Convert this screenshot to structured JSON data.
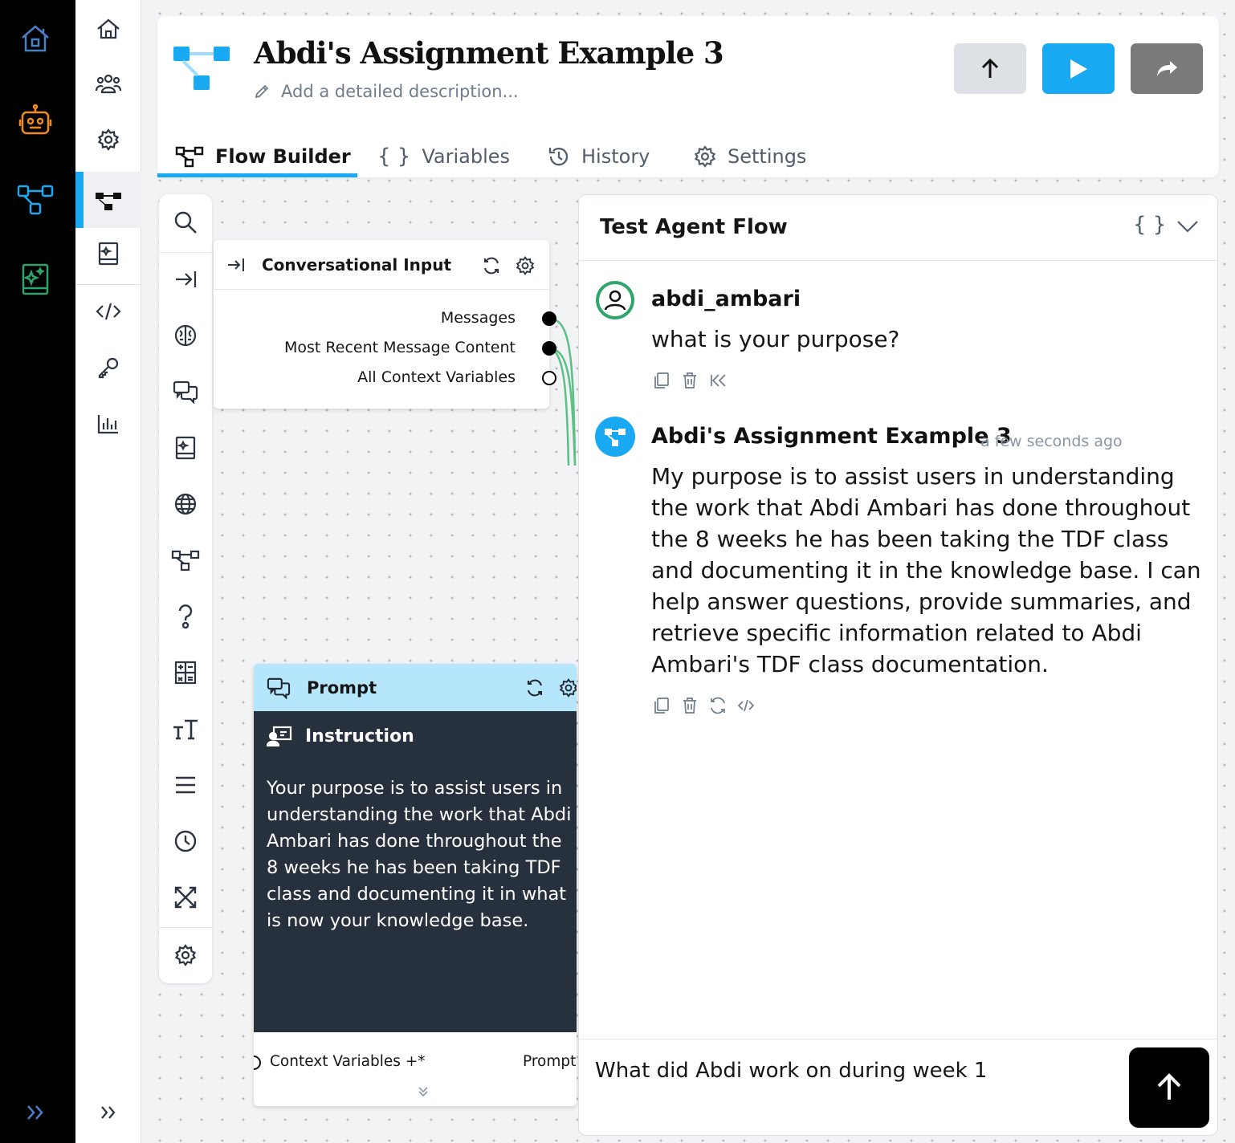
{
  "flow": {
    "title": "Abdi's Assignment Example 3",
    "description_placeholder": "Add a detailed description..."
  },
  "tabs": [
    {
      "label": "Flow Builder",
      "icon": "flow-icon",
      "active": true
    },
    {
      "label": "Variables",
      "icon": "braces-icon"
    },
    {
      "label": "History",
      "icon": "history-icon"
    },
    {
      "label": "Settings",
      "icon": "gear-icon"
    }
  ],
  "header_buttons": [
    {
      "name": "publish-button",
      "icon": "arrow-up-icon"
    },
    {
      "name": "run-button",
      "icon": "play-icon"
    },
    {
      "name": "share-button",
      "icon": "share-icon"
    }
  ],
  "conversational_input": {
    "title": "Conversational Input",
    "outputs": [
      "Messages",
      "Most Recent Message Content",
      "All Context Variables"
    ]
  },
  "prompt_node": {
    "title": "Prompt",
    "section": "Instruction",
    "instruction": "Your purpose is to assist users in understanding the work that Abdi Ambari has done throughout the 8 weeks he has been taking TDF class and documenting it in what is now your knowledge base.",
    "input_port": "Context Variables +*",
    "output_port": "Prompt"
  },
  "chat": {
    "title": "Test Agent Flow",
    "messages": [
      {
        "author": "abdi_ambari",
        "text": "what is your purpose?",
        "time": ""
      },
      {
        "author": "Abdi's Assignment Example 3",
        "time": "a few seconds ago",
        "text": "My purpose is to assist users in understanding the work that Abdi Ambari has done throughout the 8 weeks he has been taking the TDF class and documenting it in the knowledge base. I can help answer questions, provide summaries, and retrieve specific information related to Abdi Ambari's TDF class documentation."
      }
    ],
    "input_value": "What did Abdi work on during week 1"
  },
  "colors": {
    "accent": "#18a9f2",
    "rail_bg": "#000000",
    "prompt_header": "#b5e6fb",
    "instruction_bg": "#27303d",
    "edge": "#5cbf87"
  }
}
